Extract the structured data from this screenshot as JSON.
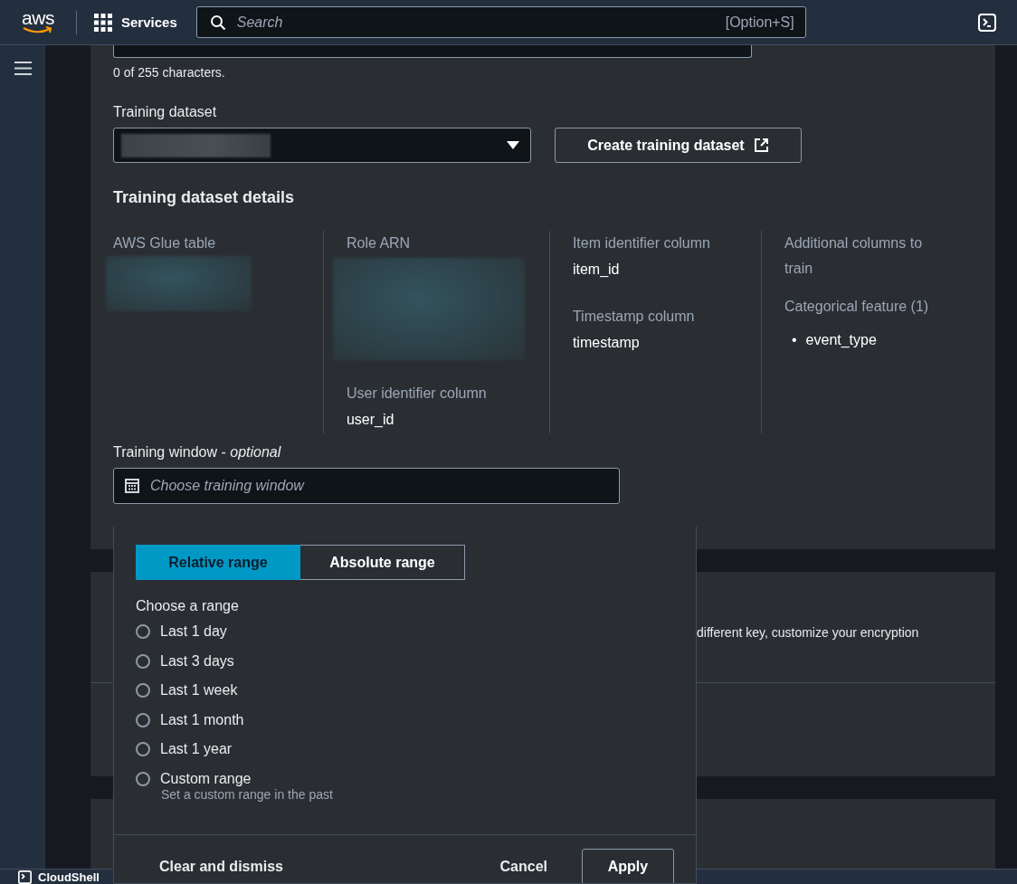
{
  "top_nav": {
    "logo": "aws",
    "services": "Services",
    "search": {
      "placeholder": "Search",
      "shortcut": "[Option+S]"
    }
  },
  "description_field": {
    "counter": "0 of 255 characters."
  },
  "training_dataset": {
    "label": "Training dataset",
    "create_button": "Create training dataset"
  },
  "details": {
    "title": "Training dataset details",
    "columns": [
      {
        "items": [
          {
            "kind": "label",
            "text": "AWS Glue table"
          },
          {
            "kind": "redacted"
          }
        ]
      },
      {
        "items": [
          {
            "kind": "label",
            "text": "Role ARN"
          },
          {
            "kind": "redacted"
          },
          {
            "kind": "label",
            "text": "User identifier column"
          },
          {
            "kind": "value",
            "text": "user_id"
          }
        ]
      },
      {
        "items": [
          {
            "kind": "label",
            "text": "Item identifier column"
          },
          {
            "kind": "value",
            "text": "item_id"
          },
          {
            "kind": "label",
            "text": "Timestamp column"
          },
          {
            "kind": "value",
            "text": "timestamp"
          }
        ]
      },
      {
        "items": [
          {
            "kind": "label",
            "text": "Additional columns to train"
          },
          {
            "kind": "label",
            "text": "Categorical feature (1)"
          },
          {
            "kind": "bullet",
            "marker": "•",
            "text": "event_type"
          }
        ]
      }
    ]
  },
  "training_window": {
    "label": "Training window - *optional*",
    "placeholder": "Choose training window"
  },
  "range_popover": {
    "tabs": [
      {
        "label": "Relative range",
        "selected": true
      },
      {
        "label": "Absolute range",
        "selected": false
      }
    ],
    "prompt": "Choose a range",
    "options": [
      {
        "label": "Last 1 day",
        "selected": false
      },
      {
        "label": "Last 3 days",
        "selected": false
      },
      {
        "label": "Last 1 week",
        "selected": false
      },
      {
        "label": "Last 1 month",
        "selected": false
      },
      {
        "label": "Last 1 year",
        "selected": false
      },
      {
        "label": "Custom range",
        "description": "Set a custom range in the past",
        "selected": false
      }
    ],
    "footer": {
      "clear": "Clear and dismiss",
      "cancel": "Cancel",
      "apply": "Apply"
    }
  },
  "encryption_panel": {
    "text": "different key, customize your encryption"
  },
  "bottom_bar": {
    "cloudshell": "CloudShell"
  }
}
